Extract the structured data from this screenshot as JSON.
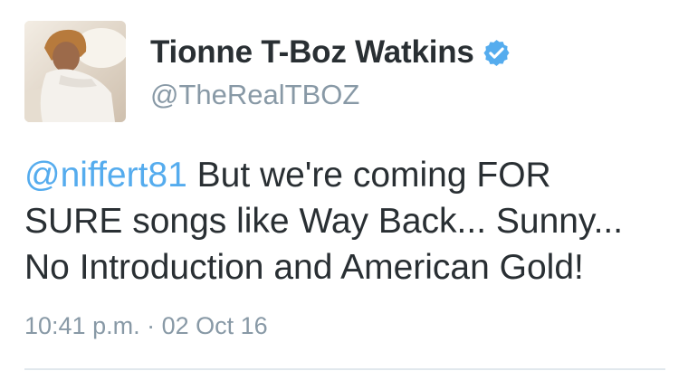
{
  "user": {
    "display_name": "Tionne T-Boz Watkins",
    "handle": "@TheRealTBOZ",
    "verified": true,
    "avatar_icon": "profile-photo",
    "verified_icon": "verified-badge-icon"
  },
  "tweet": {
    "mention": "@niffert81",
    "line1_rest": " But we're coming FOR",
    "line2": "SURE songs like Way Back... Sunny...",
    "line3": "No Introduction and American Gold!",
    "timestamp": "10:41 p.m. · 02 Oct 16"
  },
  "colors": {
    "text": "#292f33",
    "secondary": "#8899a6",
    "link": "#55acee",
    "verified": "#55acee",
    "divider": "#e1e8ed"
  }
}
